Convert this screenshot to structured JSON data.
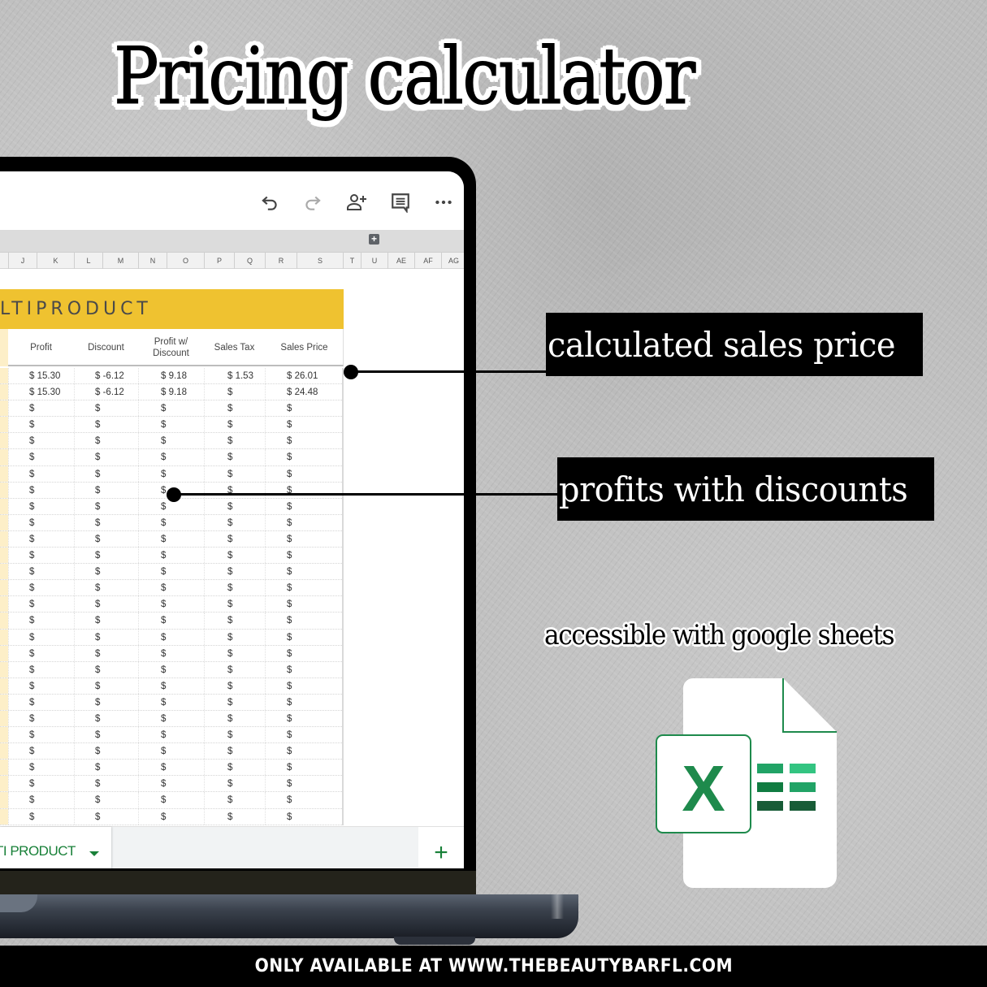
{
  "title": "Pricing calculator",
  "toolbar": {
    "icons": [
      "undo-icon",
      "redo-icon",
      "share-person-add-icon",
      "comment-icon",
      "more-icon"
    ]
  },
  "column_letters": [
    "J",
    "K",
    "L",
    "M",
    "N",
    "O",
    "P",
    "Q",
    "R",
    "S",
    "T",
    "U",
    "AE",
    "AF",
    "AG"
  ],
  "sheet": {
    "banner": "LTIPRODUCT",
    "headers": [
      "Profit",
      "Discount",
      "Profit w/\nDiscount",
      "Sales Tax",
      "Sales Price"
    ],
    "rows": [
      [
        "$ 15.30",
        "$ -6.12",
        "$ 9.18",
        "$ 1.53",
        "$ 26.01"
      ],
      [
        "$ 15.30",
        "$ -6.12",
        "$ 9.18",
        "$",
        "$ 24.48"
      ],
      [
        "$",
        "$",
        "$",
        "$",
        "$"
      ],
      [
        "$",
        "$",
        "$",
        "$",
        "$"
      ],
      [
        "$",
        "$",
        "$",
        "$",
        "$"
      ],
      [
        "$",
        "$",
        "$",
        "$",
        "$"
      ],
      [
        "$",
        "$",
        "$",
        "$",
        "$"
      ],
      [
        "$",
        "$",
        "$",
        "$",
        "$"
      ],
      [
        "$",
        "$",
        "$",
        "$",
        "$"
      ],
      [
        "$",
        "$",
        "$",
        "$",
        "$"
      ],
      [
        "$",
        "$",
        "$",
        "$",
        "$"
      ],
      [
        "$",
        "$",
        "$",
        "$",
        "$"
      ],
      [
        "$",
        "$",
        "$",
        "$",
        "$"
      ],
      [
        "$",
        "$",
        "$",
        "$",
        "$"
      ],
      [
        "$",
        "$",
        "$",
        "$",
        "$"
      ],
      [
        "$",
        "$",
        "$",
        "$",
        "$"
      ],
      [
        "$",
        "$",
        "$",
        "$",
        "$"
      ],
      [
        "$",
        "$",
        "$",
        "$",
        "$"
      ],
      [
        "$",
        "$",
        "$",
        "$",
        "$"
      ],
      [
        "$",
        "$",
        "$",
        "$",
        "$"
      ],
      [
        "$",
        "$",
        "$",
        "$",
        "$"
      ],
      [
        "$",
        "$",
        "$",
        "$",
        "$"
      ],
      [
        "$",
        "$",
        "$",
        "$",
        "$"
      ],
      [
        "$",
        "$",
        "$",
        "$",
        "$"
      ],
      [
        "$",
        "$",
        "$",
        "$",
        "$"
      ],
      [
        "$",
        "$",
        "$",
        "$",
        "$"
      ],
      [
        "$",
        "$",
        "$",
        "$",
        "$"
      ],
      [
        "$",
        "$",
        "$",
        "$",
        "$"
      ]
    ],
    "tab_label": "TI PRODUCT",
    "add_sheet_label": "+"
  },
  "callouts": {
    "sales_price": "calculated sales price",
    "discounts": "profits with discounts"
  },
  "sheets_caption": "accessible with google sheets",
  "excel_icon_letter": "X",
  "footer": "ONLY AVAILABLE AT WWW.THEBEAUTYBARFL.COM",
  "colors": {
    "banner_yellow": "#efc230",
    "sheets_green": "#188038",
    "excel_green": "#1e8a4c"
  }
}
